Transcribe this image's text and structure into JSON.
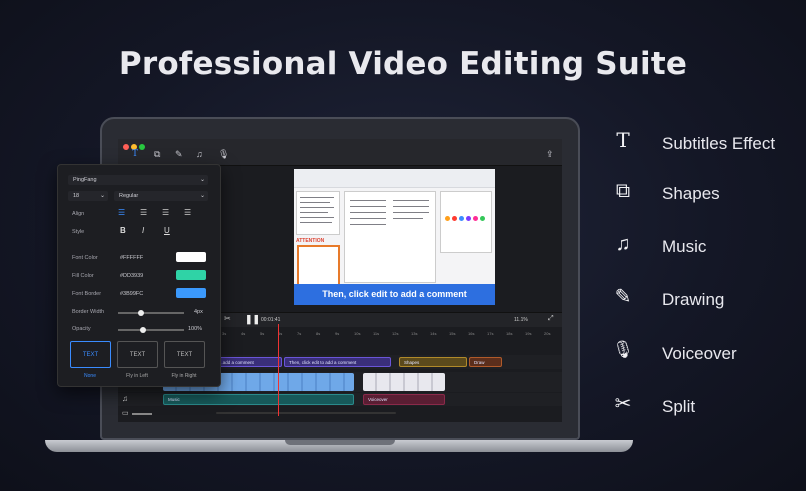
{
  "headline": "Professional Video Editing Suite",
  "features": [
    {
      "icon": "text-t-icon",
      "glyph": "T",
      "label": "Subtitles Effect"
    },
    {
      "icon": "shapes-icon",
      "glyph": "⧉",
      "label": "Shapes"
    },
    {
      "icon": "music-note-icon",
      "glyph": "♫",
      "label": "Music"
    },
    {
      "icon": "pencil-icon",
      "glyph": "✎",
      "label": "Drawing"
    },
    {
      "icon": "microphone-icon",
      "glyph": "🎙",
      "label": "Voiceover"
    },
    {
      "icon": "scissors-icon",
      "glyph": "✂",
      "label": "Split"
    }
  ],
  "editor": {
    "window_dots": [
      "#ff5f57",
      "#febc2e",
      "#28c840"
    ],
    "toolbar_icons": [
      "text-icon",
      "shapes-icon",
      "pen-icon",
      "music-icon",
      "mic-icon"
    ],
    "export_icon": "share-icon",
    "preview": {
      "attention_text": "ATTENTION",
      "caption": "Then, click edit to add a comment",
      "colors": [
        "#ff9f1a",
        "#ff3b30",
        "#3a8cff",
        "#7a3cff",
        "#ff2d95",
        "#34c759"
      ]
    },
    "panel": {
      "font_family": "PingFang",
      "font_size": "18",
      "font_weight": "Regular",
      "align_label": "Align",
      "style_label": "Style",
      "style_buttons": [
        "B",
        "I",
        "U"
      ],
      "font_color_label": "Font Color",
      "font_color": "#FFFFFF",
      "fill_color_label": "Fill Color",
      "fill_color": "#DD3939",
      "fill_swatch": "#2fd3a6",
      "border_label": "Font Border",
      "border_color": "#3B99FC",
      "border_width_label": "Border Width",
      "border_width": "4px",
      "opacity_label": "Opacity",
      "opacity": "100%",
      "animations": [
        {
          "text": "TEXT",
          "label": "None"
        },
        {
          "text": "TEXT",
          "label": "Fly in Left"
        },
        {
          "text": "TEXT",
          "label": "Fly in Right"
        }
      ]
    },
    "timeline": {
      "timecode": "00:01:41",
      "zoom": "11.1%",
      "ruler": [
        "3s",
        "4s",
        "5s",
        "6s",
        "7s",
        "8s",
        "9s",
        "10s",
        "11s",
        "12s",
        "13s",
        "14s",
        "15s",
        "16s",
        "17s",
        "18s",
        "19s",
        "20s",
        "21s"
      ],
      "clips": {
        "comment_1": "...add a comment",
        "comment_2": "Then, click edit to add a comment",
        "shapes": "Shapes",
        "draw": "Draw",
        "music": "Music",
        "voiceover": "Voiceover"
      }
    }
  }
}
